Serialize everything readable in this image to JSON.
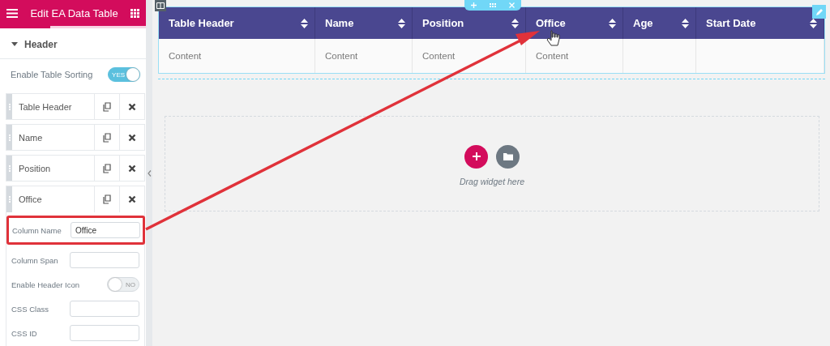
{
  "panel": {
    "title": "Edit EA Data Table",
    "section": {
      "label": "Header",
      "expanded": true
    },
    "sorting": {
      "label": "Enable Table Sorting",
      "on": true,
      "state_label": "YES"
    },
    "items": [
      {
        "label": "Table Header",
        "expanded": false
      },
      {
        "label": "Name",
        "expanded": false
      },
      {
        "label": "Position",
        "expanded": false
      },
      {
        "label": "Office",
        "expanded": true
      }
    ],
    "fields": [
      {
        "kind": "text",
        "label": "Column Name",
        "value": "Office",
        "highlighted": true
      },
      {
        "kind": "text",
        "label": "Column Span",
        "highlighted": false
      },
      {
        "kind": "toggle",
        "label": "Enable Header Icon",
        "on": false,
        "state_label": "NO",
        "highlighted": false
      },
      {
        "kind": "text",
        "label": "CSS Class",
        "highlighted": false
      },
      {
        "kind": "text",
        "label": "CSS ID",
        "highlighted": false
      }
    ]
  },
  "table": {
    "columns": [
      {
        "label": "Table Header"
      },
      {
        "label": "Name"
      },
      {
        "label": "Position"
      },
      {
        "label": "Office"
      },
      {
        "label": "Age"
      },
      {
        "label": "Start Date"
      }
    ],
    "rows": [
      [
        "Content",
        "Content",
        "Content",
        "Content",
        "",
        ""
      ]
    ]
  },
  "drop_zone": {
    "text": "Drag widget here"
  }
}
